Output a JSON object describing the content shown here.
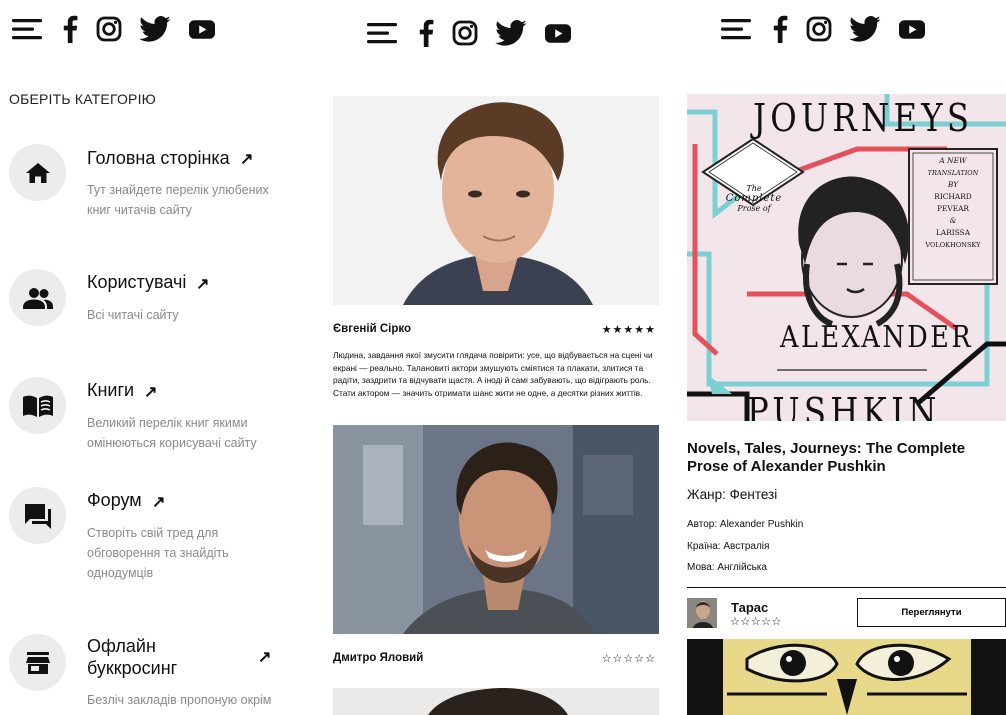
{
  "left": {
    "category_heading": "ОБЕРІТЬ КАТЕГОРІЮ",
    "categories": [
      {
        "title": "Головна сторінка",
        "desc": "Тут знайдете перелік улюбених книг читачів сайту",
        "icon": "home-icon"
      },
      {
        "title": "Користувачі",
        "desc": "Всі читачі сайту",
        "icon": "users-icon"
      },
      {
        "title": "Книги",
        "desc": "Великий перелік книг якими омінюються корисувачі сайту",
        "icon": "book-icon"
      },
      {
        "title": "Форум",
        "desc": "Створіть свій тред для обговорення та знайдіть однодумців",
        "icon": "forum-icon"
      },
      {
        "title": "Офлайн буккросинг",
        "desc": "Безліч закладів пропоную окрім",
        "icon": "store-icon"
      }
    ],
    "arrow": "↗"
  },
  "middle": {
    "people": [
      {
        "name": "Євгеній Сірко",
        "stars": "★★★★★",
        "desc": "Людина, завдання якої змусити глядача повірити: усе, що відбувається на сцені чи екрані — реально. Талановиті актори змушують сміятися та плакати, злитися та радіти, заздрити та відчувати щастя. А іноді й самі забувають, що відіграють роль. Стати актором — значить отримати шанс жити не одне, а десятки різних життів."
      },
      {
        "name": "Дмитро Яловий",
        "stars": "☆☆☆☆☆"
      }
    ]
  },
  "right": {
    "book": {
      "cover_title": "JOURNEYS",
      "cover_box_1": "The",
      "cover_box_2": "Complete",
      "cover_box_3": "Prose of",
      "cover_tag": [
        "A NEW",
        "TRANSLATION",
        "BY",
        "RICHARD",
        "PEVEAR",
        "&",
        "LARISSA",
        "VOLOKHONSKY"
      ],
      "cover_author_1": "ALEXANDER",
      "cover_author_2": "PUSHKIN",
      "title": "Novels, Tales, Journeys: The Complete Prose of Alexander Pushkin",
      "genre": "Жанр: Фентезі",
      "author": "Автор: Alexander Pushkin",
      "country": "Країна: Австралія",
      "language": "Мова: Англійська"
    },
    "reviewer": {
      "name": "Тарас",
      "stars": "☆☆☆☆☆"
    },
    "view_button": "Переглянути"
  },
  "social_icons": [
    "menu-icon",
    "facebook-icon",
    "instagram-icon",
    "twitter-icon",
    "youtube-icon"
  ],
  "colors": {
    "accent_teal": "#7ccfd3",
    "accent_red": "#e4505b",
    "circle_bg": "#ececec",
    "muted_text": "#8a8a8a"
  }
}
